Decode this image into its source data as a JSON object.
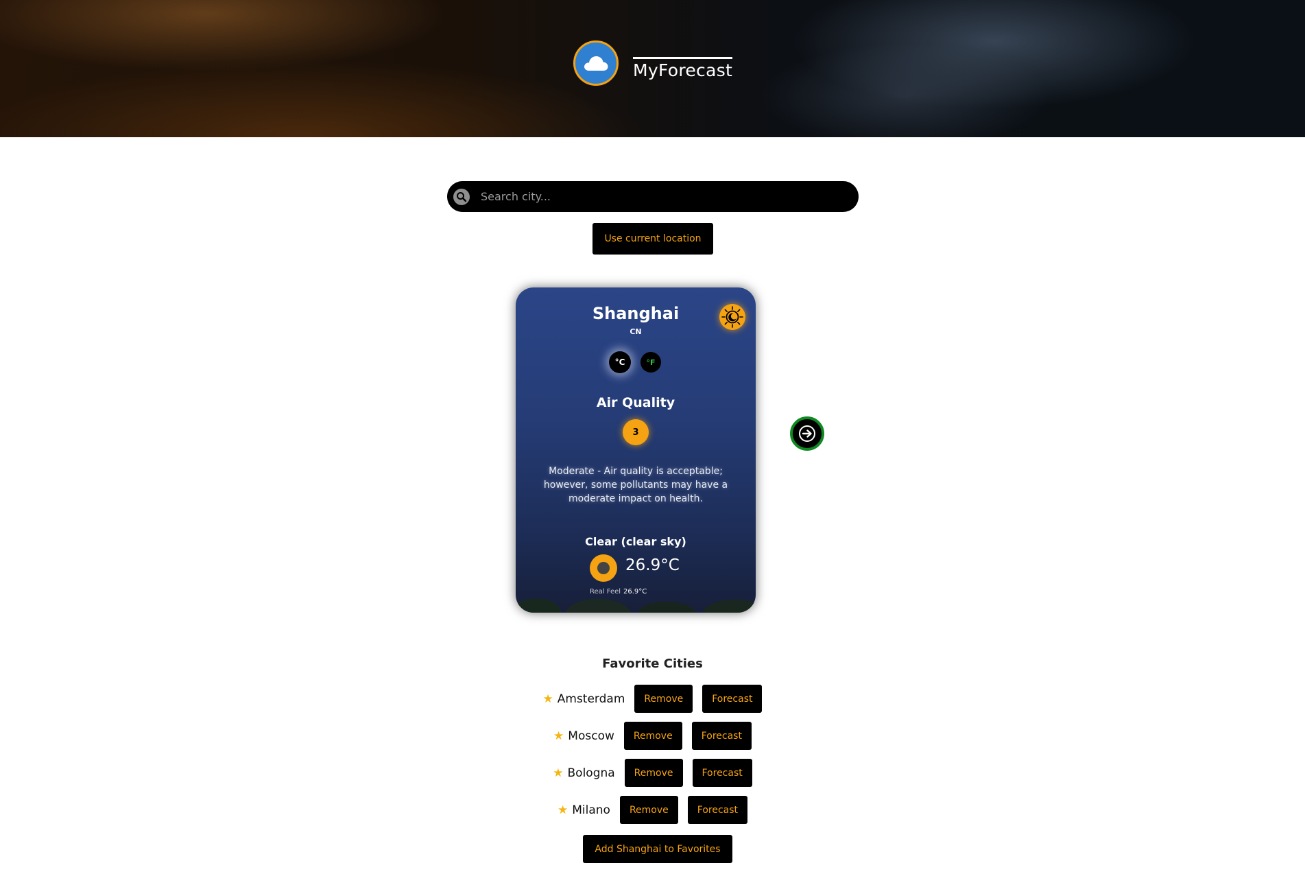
{
  "header": {
    "logo_icon": "cloud-icon",
    "app_title": "MyForecast"
  },
  "search": {
    "icon": "search-icon",
    "placeholder": "Search city..."
  },
  "location_button_label": "Use current location",
  "weather_card": {
    "city": "Shanghai",
    "country": "CN",
    "theme_toggle_icon": "sun-moon-icon",
    "units": {
      "celsius_label": "°C",
      "fahrenheit_label": "°F",
      "selected": "°C"
    },
    "air_quality": {
      "title": "Air Quality",
      "index": "3",
      "description": "Moderate - Air quality is acceptable; however, some pollutants may have a moderate impact on health."
    },
    "condition": "Clear (clear sky)",
    "condition_icon": "clear-sky-icon",
    "temperature": "26.9°C",
    "real_feel_label": "Real Feel",
    "real_feel_value": "26.9°C"
  },
  "next_button_icon": "arrow-right-icon",
  "favorites": {
    "title": "Favorite Cities",
    "items": [
      {
        "name": "Amsterdam",
        "remove_label": "Remove",
        "forecast_label": "Forecast"
      },
      {
        "name": "Moscow",
        "remove_label": "Remove",
        "forecast_label": "Forecast"
      },
      {
        "name": "Bologna",
        "remove_label": "Remove",
        "forecast_label": "Forecast"
      },
      {
        "name": "Milano",
        "remove_label": "Remove",
        "forecast_label": "Forecast"
      }
    ],
    "add_label": "Add Shanghai to Favorites"
  },
  "colors": {
    "accent": "#f5a312",
    "button_bg": "#000000",
    "next_button_ring": "#0f8a22",
    "fahrenheit_text": "#2bbf4b",
    "logo_bg": "#2f80d1"
  }
}
